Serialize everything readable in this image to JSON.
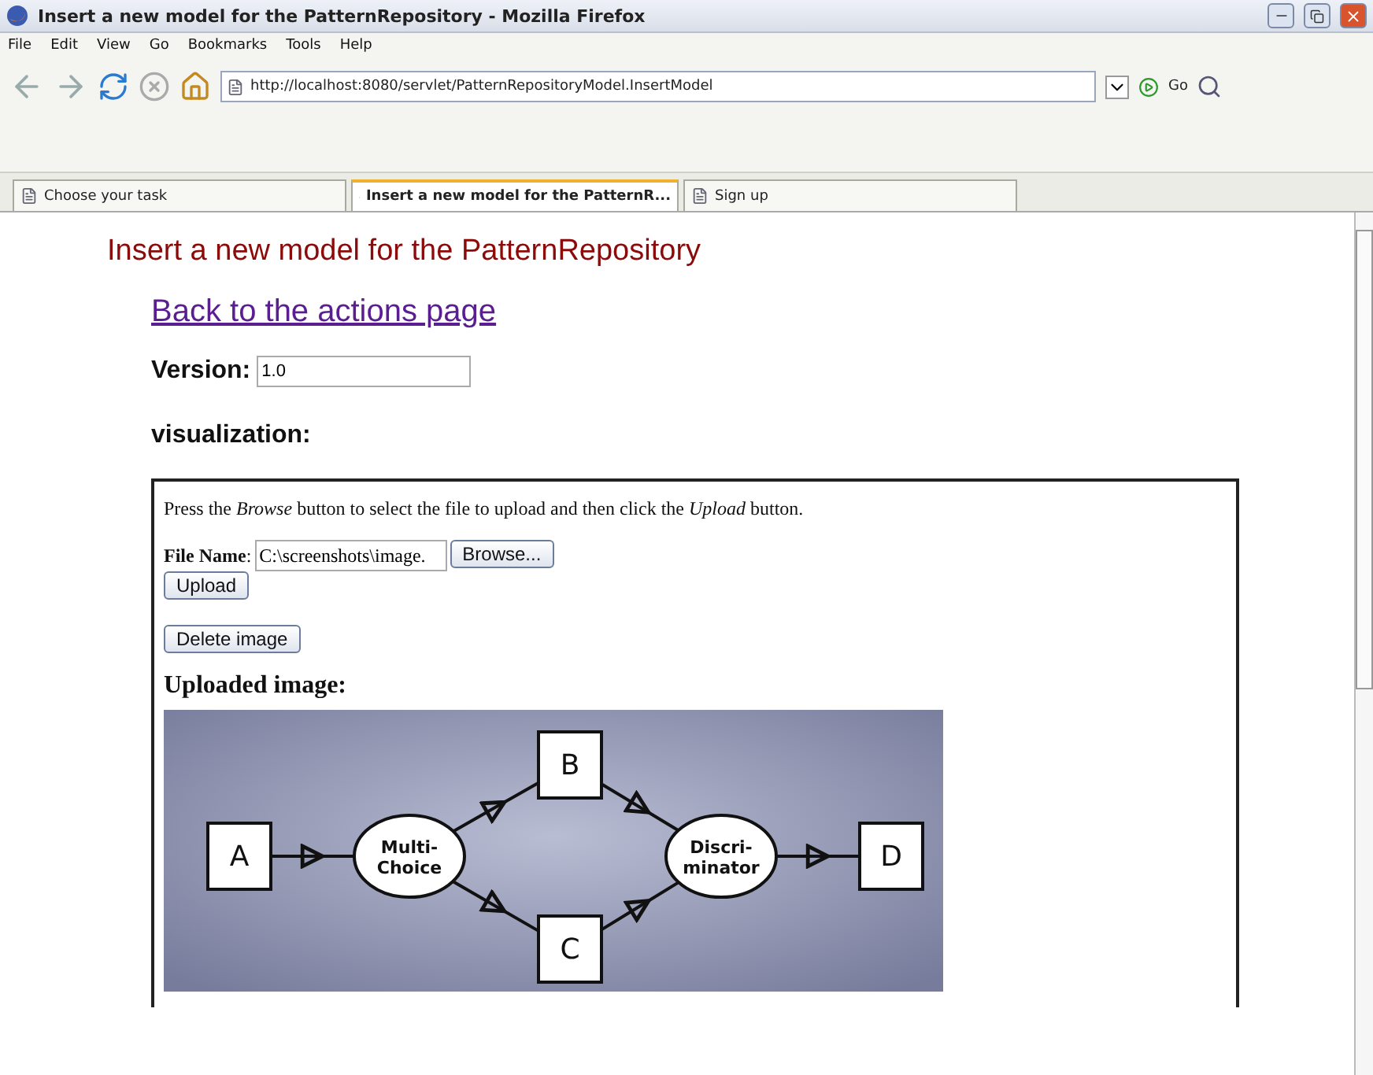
{
  "window": {
    "title": "Insert a new model for the PatternRepository - Mozilla Firefox"
  },
  "menu": [
    "File",
    "Edit",
    "View",
    "Go",
    "Bookmarks",
    "Tools",
    "Help"
  ],
  "address_bar": {
    "url": "http://localhost:8080/servlet/PatternRepositoryModel.InsertModel",
    "go_label": "Go"
  },
  "tabs": [
    {
      "label": "Choose your task",
      "selected": false
    },
    {
      "label": "Insert a new model for the PatternR...",
      "selected": true
    },
    {
      "label": "Sign up",
      "selected": false
    }
  ],
  "page": {
    "heading": "Insert a new model for the PatternRepository",
    "back_link": "Back to the actions page",
    "version_label": "Version:",
    "version_value": "1.0",
    "visualization_label": "visualization:",
    "upload_panel": {
      "instructions": "Press the *Browse* button to select the file to upload and then click the *Upload* button.",
      "file_label": "**File Name**:",
      "file_value": "C:\\screenshots\\image.",
      "browse_button": "Browse...",
      "upload_button": "Upload",
      "delete_button": "Delete image",
      "uploaded_heading": "Uploaded image:",
      "diagram": {
        "nodes": [
          {
            "label": "A",
            "kind": "box"
          },
          {
            "label": "Multi-\nChoice",
            "kind": "ellipse"
          },
          {
            "label": "B",
            "kind": "box"
          },
          {
            "label": "C",
            "kind": "box"
          },
          {
            "label": "Discri-\nminator",
            "kind": "ellipse"
          },
          {
            "label": "D",
            "kind": "box"
          }
        ]
      }
    }
  }
}
